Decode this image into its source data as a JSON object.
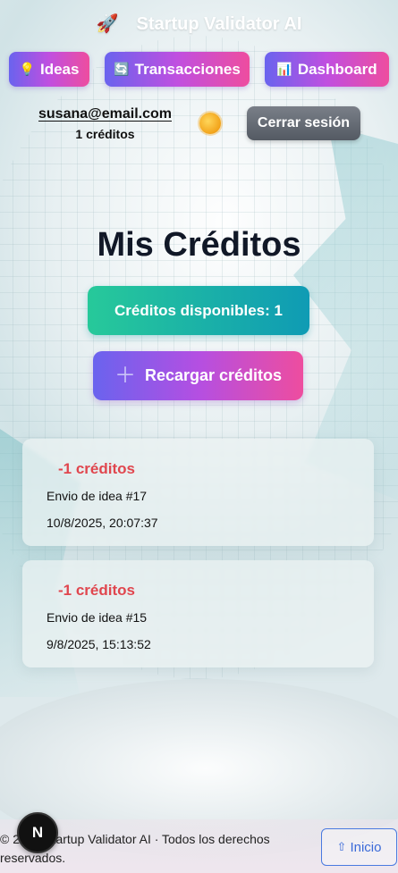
{
  "header": {
    "icon": "rocket-icon",
    "rocket_glyph": "🚀",
    "title": "Startup Validator AI"
  },
  "nav": {
    "ideas": {
      "icon": "lightbulb-icon",
      "glyph": "💡",
      "label": "Ideas"
    },
    "transacciones": {
      "icon": "exchange-icon",
      "glyph": "🔄",
      "label": "Transacciones"
    },
    "dashboard": {
      "icon": "bar-chart-icon",
      "glyph": "📊",
      "label": "Dashboard"
    }
  },
  "user": {
    "email": "susana@email.com",
    "credits": "1 créditos",
    "theme_icon": "sun-icon",
    "logout_label": "Cerrar sesión"
  },
  "main": {
    "title": "Mis Créditos",
    "available_label": "Créditos disponibles: 1",
    "recharge_label": "Recargar créditos",
    "recharge_icon": "plus-icon"
  },
  "transactions": [
    {
      "amount": "-1 créditos",
      "description": "Envio de idea #17",
      "date": "10/8/2025, 20:07:37"
    },
    {
      "amount": "-1 créditos",
      "description": "Envio de idea #15",
      "date": "9/8/2025, 15:13:52"
    }
  ],
  "footer": {
    "text": "© 2025 Startup Validator AI · Todos los derechos reservados.",
    "badge": "N",
    "inicio_label": "Inicio",
    "inicio_icon": "arrow-up-icon"
  },
  "colors": {
    "accent_gradient": [
      "#6a63ee",
      "#ee4d9f"
    ],
    "credits_gradient": [
      "#27c99a",
      "#0f9bb4"
    ],
    "debit": "#e0464e"
  }
}
